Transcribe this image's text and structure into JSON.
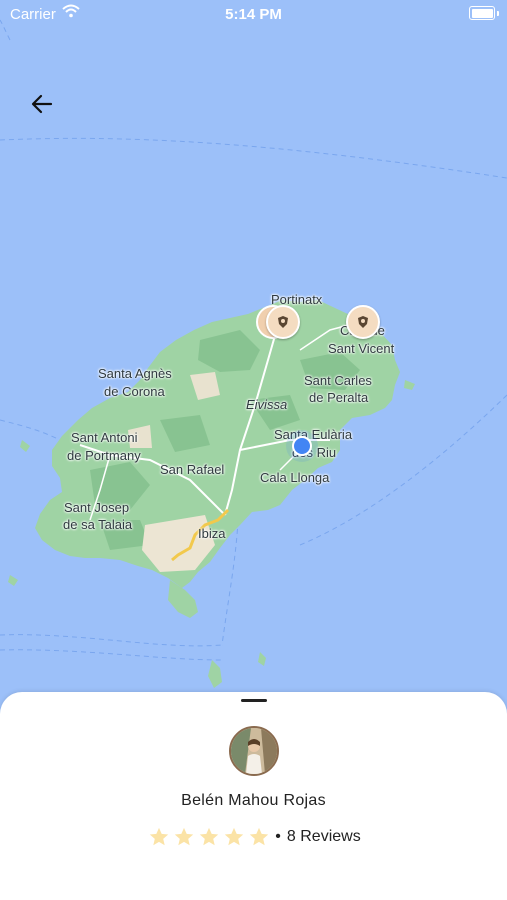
{
  "status_bar": {
    "carrier": "Carrier",
    "time": "5:14 PM"
  },
  "map": {
    "labels": [
      "Portinatx",
      "Cala de",
      "Sant Vicent",
      "Santa Agnès",
      "de Corona",
      "Sant Carles",
      "de Peralta",
      "Eivissa",
      "Sant Antoni",
      "de Portmany",
      "Santa Eulària",
      "des Riu",
      "San Rafael",
      "Cala Llonga",
      "Sant Josep",
      "de sa Talaia",
      "Ibiza"
    ],
    "colors": {
      "sea": "#9cc0f9",
      "land": "#9fd3a4",
      "user_dot": "#4285f4"
    },
    "icons": [
      "arrow-left-icon",
      "map-pin-icon",
      "location-dot-icon"
    ]
  },
  "profile": {
    "name": "Belén Mahou Rojas",
    "rating": 5,
    "rating_max": 5,
    "reviews_separator": "•",
    "reviews_label": "8 Reviews",
    "star_color": "#fbe3a6"
  }
}
